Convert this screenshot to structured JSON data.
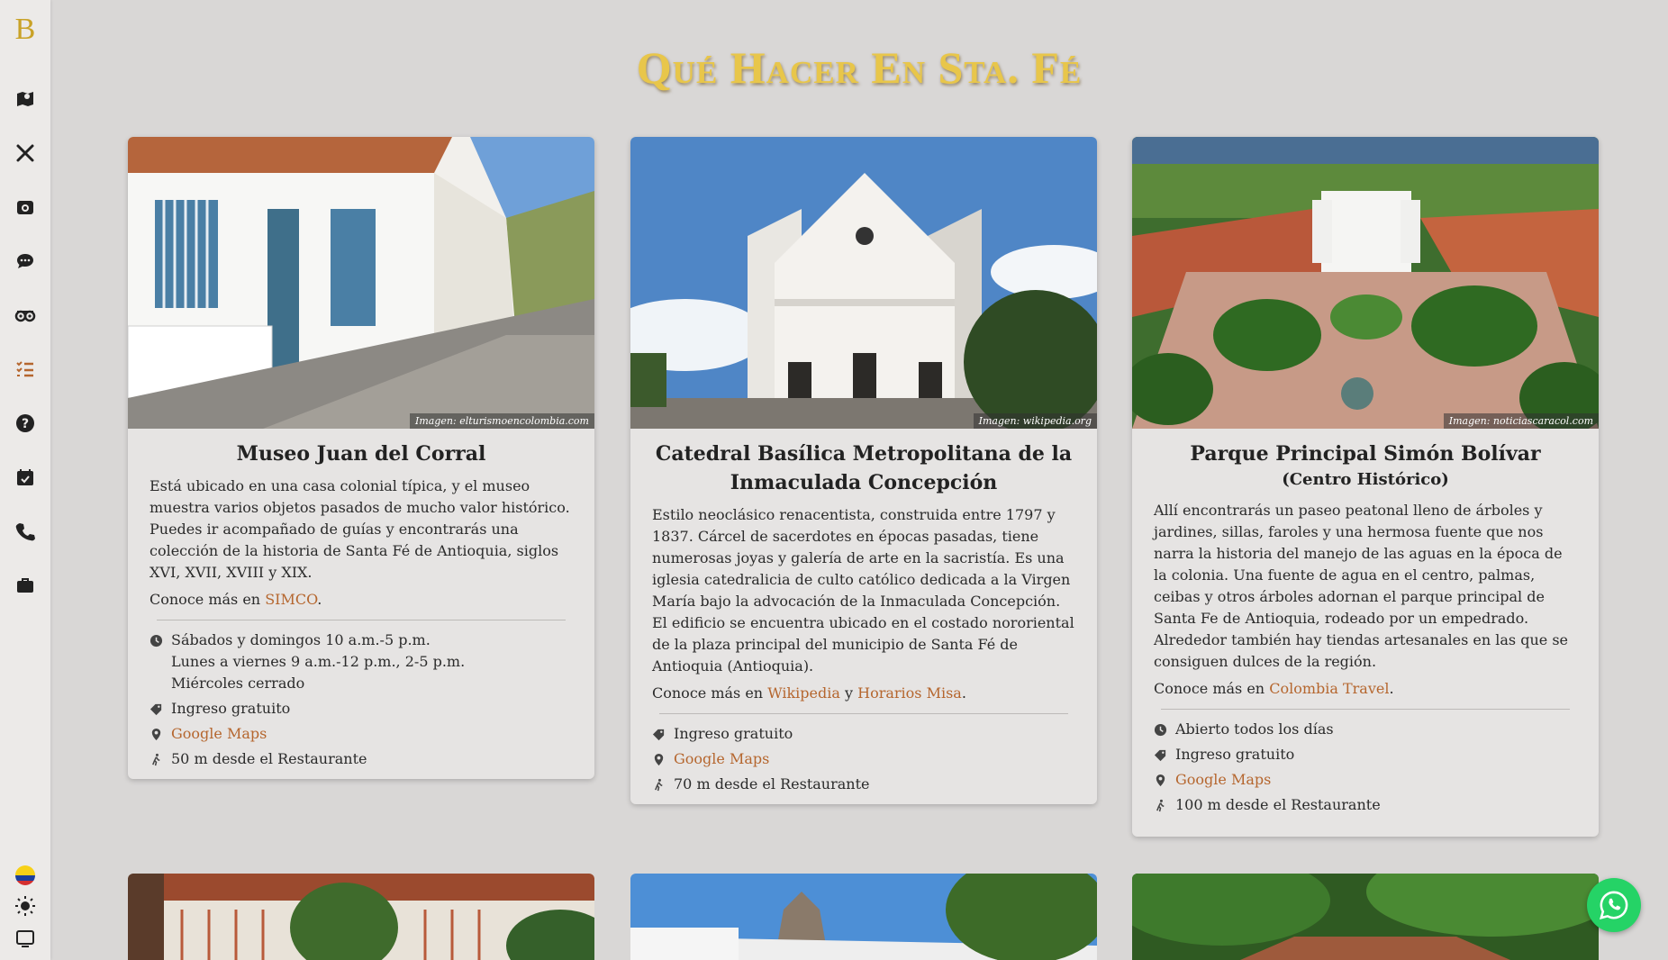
{
  "app": {
    "logo": "B",
    "title": "Qué Hacer En Sta. Fé"
  },
  "sidebar": {
    "items": [
      {
        "icon": "map-icon"
      },
      {
        "icon": "utensils-icon"
      },
      {
        "icon": "camera-icon"
      },
      {
        "icon": "chat-icon"
      },
      {
        "icon": "tripadvisor-icon"
      },
      {
        "icon": "checklist-icon"
      },
      {
        "icon": "help-icon"
      },
      {
        "icon": "calendar-icon"
      },
      {
        "icon": "phone-icon"
      },
      {
        "icon": "briefcase-icon"
      }
    ],
    "bottom": [
      {
        "icon": "colombia-flag-icon"
      },
      {
        "icon": "sun-icon"
      },
      {
        "icon": "screen-icon"
      }
    ]
  },
  "cards": [
    {
      "title": "Museo Juan del Corral",
      "image_credit": "Imagen: elturismoencolombia.com",
      "description": "Está ubicado en una casa colonial típica, y el museo muestra varios objetos pasados de mucho valor histórico. Puedes ir acompañado de guías y encontrarás una colección de la historia de Santa Fé de Antioquia, siglos XVI, XVII, XVIII y XIX.",
      "more_prefix": "Conoce más en ",
      "links": [
        "SIMCO"
      ],
      "more_suffix": ".",
      "schedule": [
        "Sábados y domingos 10 a.m.-5 p.m.",
        "Lunes a viernes 9 a.m.-12 p.m., 2-5 p.m.",
        "Miércoles cerrado"
      ],
      "price": "Ingreso gratuito",
      "map_label": "Google Maps",
      "distance": "50 m desde el Restaurante"
    },
    {
      "title": "Catedral Basílica Metropolitana de la Inmaculada Concepción",
      "image_credit": "Imagen: wikipedia.org",
      "description": "Estilo neoclásico renacentista, construida entre 1797 y 1837. Cárcel de sacerdotes en épocas pasadas, tiene numerosas joyas y galería de arte en la sacristía. Es una iglesia catedralicia de culto católico dedicada a la Virgen María bajo la advocación de la Inmaculada Concepción. El edificio se encuentra ubicado en el costado nororiental de la plaza principal del municipio de Santa Fé de Antioquia (Antioquia).",
      "more_prefix": "Conoce más en ",
      "links": [
        "Wikipedia",
        "Horarios Misa"
      ],
      "link_joiner": " y ",
      "more_suffix": ".",
      "price": "Ingreso gratuito",
      "map_label": "Google Maps",
      "distance": "70 m desde el Restaurante"
    },
    {
      "title": "Parque Principal Simón Bolívar",
      "subtitle": "(Centro Histórico)",
      "image_credit": "Imagen: noticiascaracol.com",
      "description": "Allí encontrarás un paseo peatonal lleno de árboles y jardines, sillas, faroles y una hermosa fuente que nos narra la historia del manejo de las aguas en la época de la colonia. Una fuente de agua en el centro, palmas, ceibas y otros árboles adornan el parque principal de Santa Fe de Antioquia, rodeado por un empedrado. Alrededor también hay tiendas artesanales en las que se consiguen dulces de la región.",
      "more_prefix": "Conoce más en ",
      "links": [
        "Colombia Travel"
      ],
      "more_suffix": ".",
      "schedule": [
        "Abierto todos los días"
      ],
      "price": "Ingreso gratuito",
      "map_label": "Google Maps",
      "distance": "100 m desde el Restaurante"
    }
  ],
  "colors": {
    "accent": "#b5662e",
    "title_gold": "#e8c64a",
    "whatsapp": "#25d366"
  }
}
